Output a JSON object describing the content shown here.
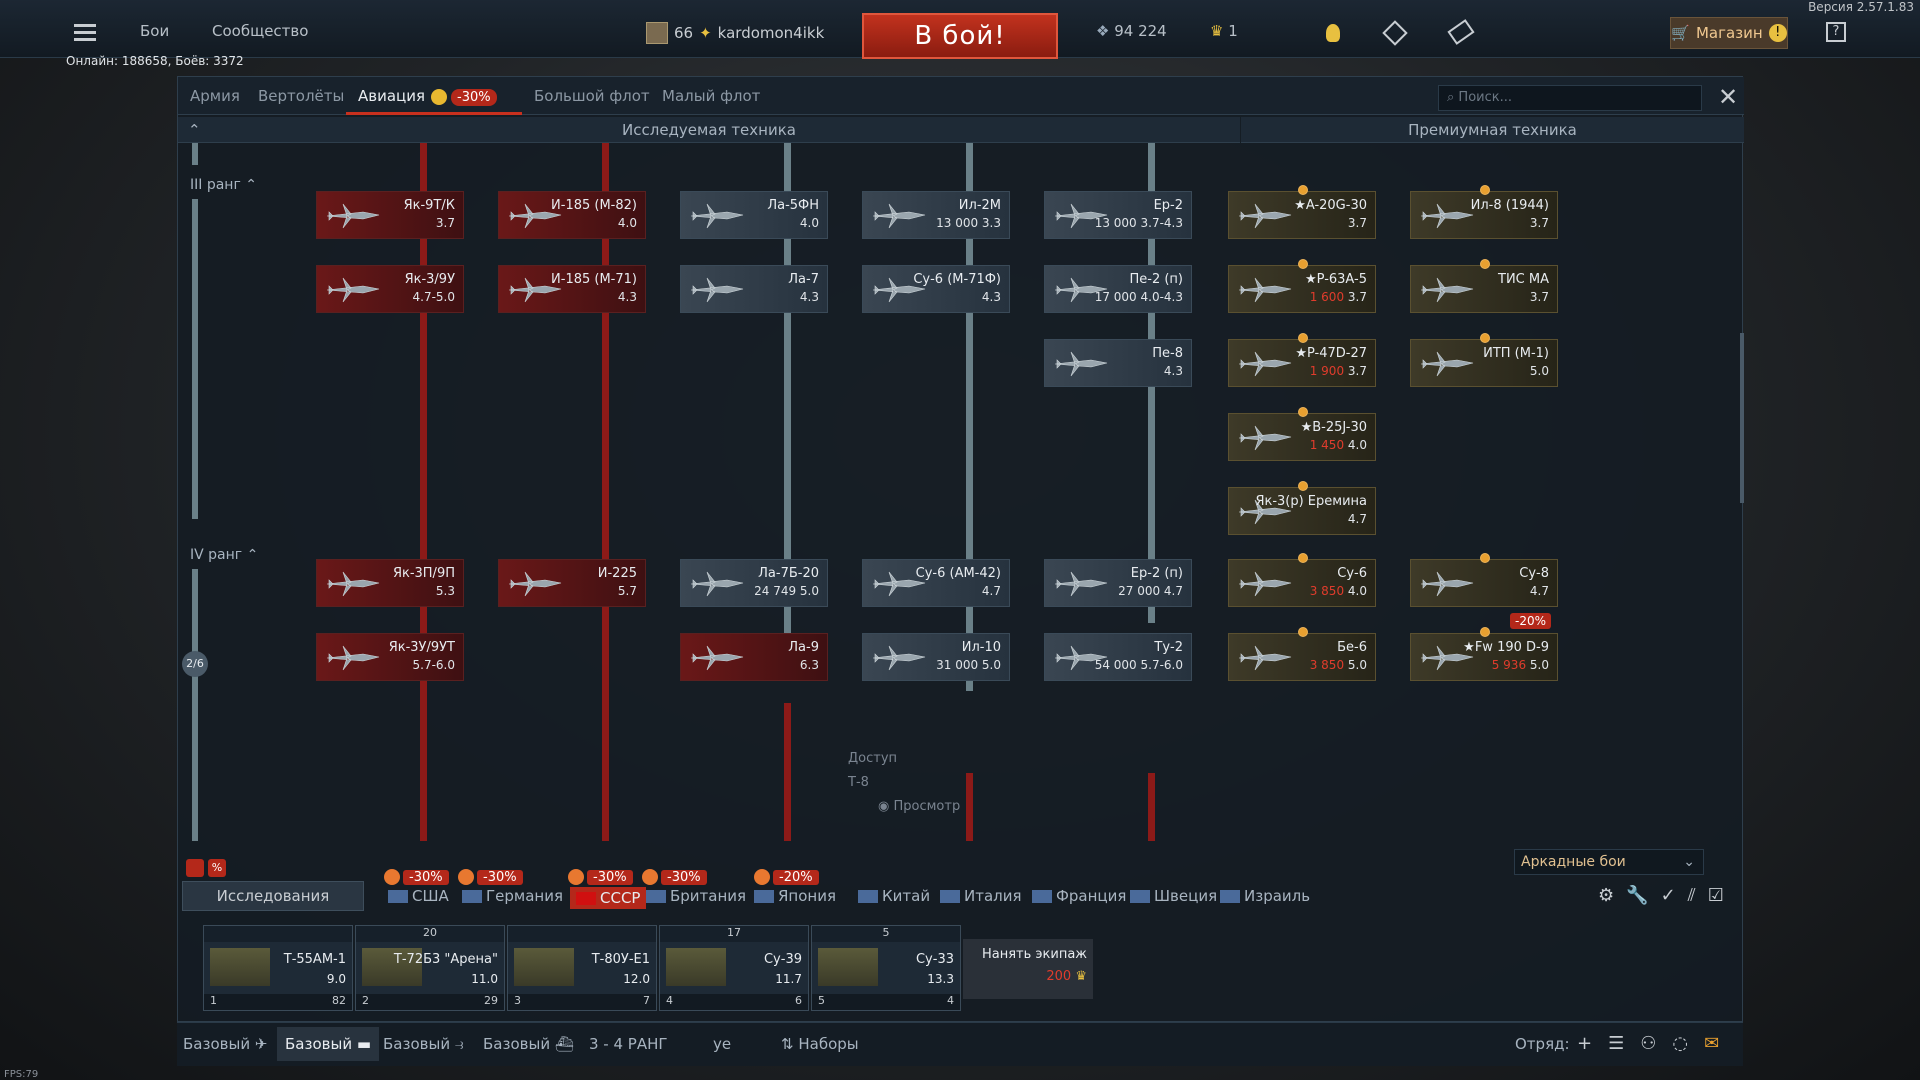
{
  "version": "Версия 2.57.1.83",
  "topnav": {
    "battles": "Бои",
    "community": "Сообщество"
  },
  "player": {
    "level": "66",
    "name": "kardomon4ikk"
  },
  "battle_button": "В бой!",
  "currency": {
    "silver": "94 224",
    "gold": "1"
  },
  "shop": "Магазин",
  "online": "Онлайн: 188658, Боёв: 3372",
  "tabs": {
    "army": "Армия",
    "helicopters": "Вертолёты",
    "aviation": "Авиация",
    "aviation_discount": "-30%",
    "bigfleet": "Большой флот",
    "smallfleet": "Малый флот"
  },
  "search_placeholder": "Поиск...",
  "columns": {
    "researched": "Исследуемая техника",
    "premium": "Премиумная техника"
  },
  "ranks": {
    "r3": "III ранг",
    "r4": "IV ранг",
    "r4_progress": "2/6"
  },
  "cards": [
    {
      "name": "Як-9Т/К",
      "meta": "3.7"
    },
    {
      "name": "И-185 (М-82)",
      "meta": "4.0"
    },
    {
      "name": "Ла-5ФН",
      "meta": "4.0"
    },
    {
      "name": "Ил-2М",
      "meta": "13 000  3.3"
    },
    {
      "name": "Ер-2",
      "meta": "13 000  3.7-4.3"
    },
    {
      "name": "Як-3/9У",
      "meta": "4.7-5.0"
    },
    {
      "name": "И-185 (М-71)",
      "meta": "4.3"
    },
    {
      "name": "Ла-7",
      "meta": "4.3"
    },
    {
      "name": "Су-6 (М-71Ф)",
      "meta": "4.3"
    },
    {
      "name": "Пе-2 (п)",
      "meta": "17 000  4.0-4.3"
    },
    {
      "name": "Пе-8",
      "meta": "4.3"
    },
    {
      "name": "Як-3П/9П",
      "meta": "5.3"
    },
    {
      "name": "И-225",
      "meta": "5.7"
    },
    {
      "name": "Ла-7Б-20",
      "meta": "24 749  5.0"
    },
    {
      "name": "Су-6 (АМ-42)",
      "meta": "4.7"
    },
    {
      "name": "Ер-2 (п)",
      "meta": "27 000  4.7"
    },
    {
      "name": "Як-3У/9УТ",
      "meta": "5.7-6.0"
    },
    {
      "name": "Ла-9",
      "meta": "6.3"
    },
    {
      "name": "Ил-10",
      "meta": "31 000  5.0"
    },
    {
      "name": "Ту-2",
      "meta": "54 000  5.7-6.0"
    }
  ],
  "premium": [
    {
      "name": "★A-20G-30",
      "meta": "3.7"
    },
    {
      "name": "Ил-8 (1944)",
      "meta": "3.7"
    },
    {
      "name": "★P-63A-5",
      "cost": "1 600",
      "meta": "3.7"
    },
    {
      "name": "ТИС МА",
      "meta": "3.7"
    },
    {
      "name": "★P-47D-27",
      "cost": "1 900",
      "meta": "3.7"
    },
    {
      "name": "ИТП (М-1)",
      "meta": "5.0"
    },
    {
      "name": "★B-25J-30",
      "cost": "1 450",
      "meta": "4.0"
    },
    {
      "name": "Як-3(р) Еремина",
      "meta": "4.7"
    },
    {
      "name": "Су-6",
      "cost": "3 850",
      "meta": "4.0"
    },
    {
      "name": "Су-8",
      "meta": "4.7"
    },
    {
      "name": "Бе-6",
      "cost": "3 850",
      "meta": "5.0"
    },
    {
      "name": "★Fw 190 D-9",
      "cost": "5 936",
      "meta": "5.0",
      "discount": "-20%"
    }
  ],
  "overlay": {
    "text1": "Доступ",
    "text2": "Т-8",
    "text3": "Просмотр"
  },
  "mode_select": "Аркадные бои",
  "research_button": "Исследования",
  "nations": [
    "США",
    "Германия",
    "СССР",
    "Британия",
    "Япония",
    "Китай",
    "Италия",
    "Франция",
    "Швеция",
    "Израиль"
  ],
  "nation_discounts": [
    "-30%",
    "-30%",
    "-30%",
    "-30%",
    "-20%"
  ],
  "slots": [
    {
      "head": "",
      "name": "Т-55АМ-1",
      "br": "9.0",
      "n": "1",
      "pts": "82"
    },
    {
      "head": "20",
      "name": "Т-72Б3 \"Арена\"",
      "br": "11.0",
      "n": "2",
      "pts": "29"
    },
    {
      "head": "",
      "name": "Т-80У-Е1",
      "br": "12.0",
      "n": "3",
      "pts": "7"
    },
    {
      "head": "17",
      "name": "Су-39",
      "br": "11.7",
      "n": "4",
      "pts": "6"
    },
    {
      "head": "5",
      "name": "Су-33",
      "br": "13.3",
      "n": "5",
      "pts": "4"
    }
  ],
  "hire": {
    "label": "Нанять экипаж",
    "cost": "200"
  },
  "footer": {
    "b1": "Базовый",
    "b2": "Базовый",
    "b3": "Базовый",
    "b4": "Базовый",
    "rank": "3 - 4 РАНГ",
    "ye": "уе",
    "sets": "Наборы",
    "squad": "Отряд:"
  },
  "fps": "FPS:79"
}
